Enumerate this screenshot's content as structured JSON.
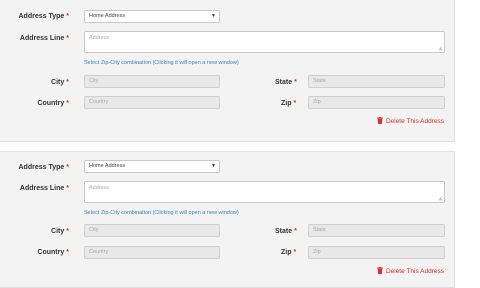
{
  "labels": {
    "address_type": "Address Type",
    "address_line": "Address Line",
    "city": "City",
    "state": "State",
    "country": "Country",
    "zip": "Zip",
    "required_marker": "*"
  },
  "link_text": "Select Zip-City combination (Clicking it will open a new window)",
  "delete_label": "Delete This Address",
  "addresses": [
    {
      "address_type_value": "Home Address",
      "address_line_placeholder": "Address",
      "city_placeholder": "City",
      "state_placeholder": "State",
      "country_placeholder": "Country",
      "zip_placeholder": "Zip"
    },
    {
      "address_type_value": "Home Address",
      "address_line_placeholder": "Address",
      "city_placeholder": "City",
      "state_placeholder": "State",
      "country_placeholder": "Country",
      "zip_placeholder": "Zip"
    }
  ],
  "colors": {
    "panel_bg": "#f3f3f3",
    "required": "#d9302c",
    "link": "#3b7fc4",
    "delete": "#d9302c"
  },
  "icons": {
    "delete": "trash-icon",
    "dropdown": "chevron-down-icon",
    "resize": "resize-grip-icon"
  }
}
